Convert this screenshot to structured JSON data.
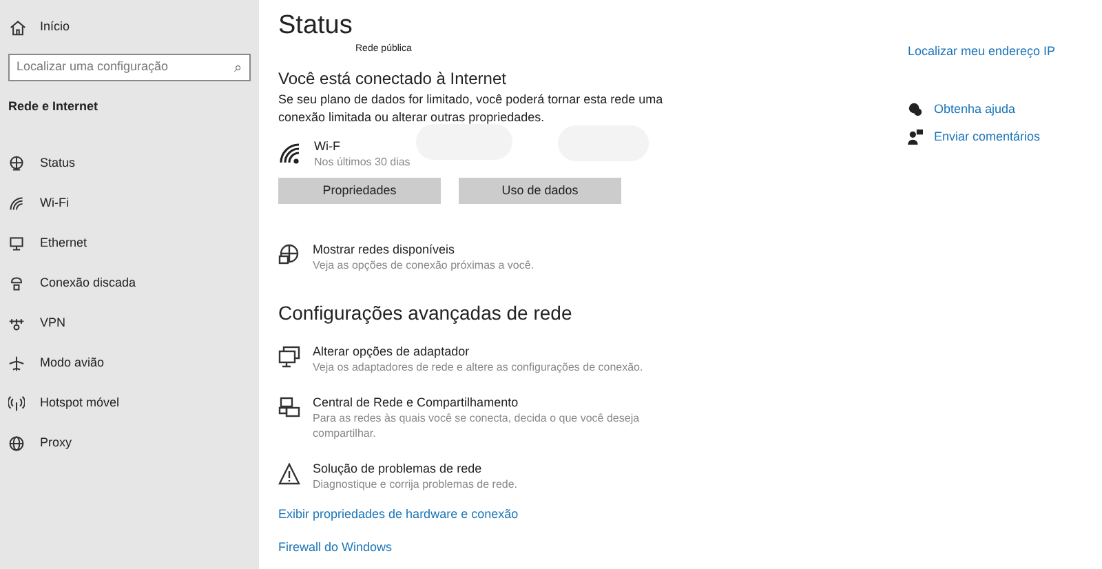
{
  "sidebar": {
    "home": "Início",
    "search": {
      "placeholder": "Localizar uma configuração",
      "icon": "⌕"
    },
    "section": "Rede e Internet",
    "items": [
      {
        "label": "Status"
      },
      {
        "label": "Wi-Fi"
      },
      {
        "label": "Ethernet"
      },
      {
        "label": "Conexão discada"
      },
      {
        "label": "VPN"
      },
      {
        "label": "Modo avião"
      },
      {
        "label": "Hotspot móvel"
      },
      {
        "label": "Proxy"
      }
    ]
  },
  "main": {
    "title": "Status",
    "network_type": "Rede pública",
    "connected_heading": "Você está conectado à Internet",
    "connected_text": "Se seu plano de dados for limitado, você poderá tornar esta rede uma conexão limitada ou alterar outras propriedades.",
    "connection": {
      "name": "Wi-F",
      "usage": "Nos últimos 30 dias"
    },
    "buttons": [
      "Propriedades",
      "Uso de dados"
    ],
    "show_networks": {
      "title": "Mostrar redes disponíveis",
      "description": "Veja as opções de conexão próximas a você."
    },
    "advanced_heading": "Configurações avançadas de rede",
    "advanced_items": [
      {
        "kind": "adapter",
        "title": "Alterar opções de adaptador",
        "description": "Veja os adaptadores de rede e altere as configurações de conexão."
      },
      {
        "kind": "sharing",
        "title": "Central de Rede e Compartilhamento",
        "description": "Para as redes às quais você se conecta, decida o que você deseja compartilhar."
      },
      {
        "kind": "troubleshoot",
        "title": "Solução de problemas de rede",
        "description": "Diagnostique e corrija problemas de rede."
      }
    ],
    "links": [
      "Exibir propriedades de hardware e conexão",
      "Firewall do Windows"
    ]
  },
  "side_panel": {
    "link": "Localizar meu endereço IP",
    "help_links": [
      {
        "kind": "help",
        "label": "Obtenha ajuda"
      },
      {
        "kind": "feedback",
        "label": "Enviar comentários"
      }
    ]
  }
}
